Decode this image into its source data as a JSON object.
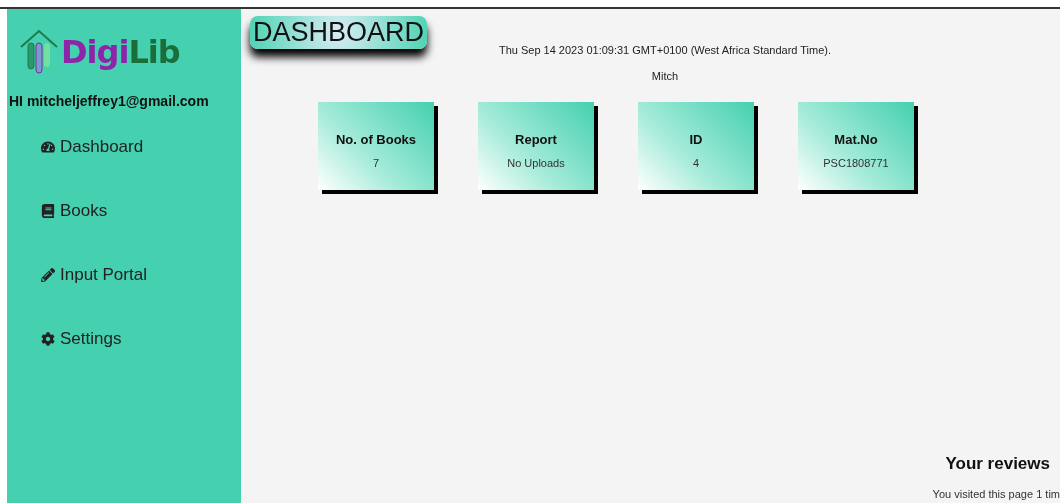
{
  "sidebar": {
    "logo": {
      "first": "Digi",
      "second": "Lib"
    },
    "greeting": "HI mitcheljeffrey1@gmail.com",
    "items": [
      {
        "kind": "dashboard",
        "label": "Dashboard"
      },
      {
        "kind": "books",
        "label": "Books"
      },
      {
        "kind": "input",
        "label": "Input Portal"
      },
      {
        "kind": "settings",
        "label": "Settings"
      }
    ]
  },
  "main": {
    "title": "DASHBOARD",
    "date": "Thu Sep 14 2023 01:09:31 GMT+0100 (West Africa Standard Time).",
    "user": "Mitch",
    "cards": [
      {
        "label": "No. of Books",
        "value": "7"
      },
      {
        "label": "Report",
        "value": "No Uploads"
      },
      {
        "label": "ID",
        "value": "4"
      },
      {
        "label": "Mat.No",
        "value": "PSC1808771"
      }
    ],
    "reviews": {
      "heading": "Your reviews",
      "text": "You visited this page 1 tim"
    }
  }
}
